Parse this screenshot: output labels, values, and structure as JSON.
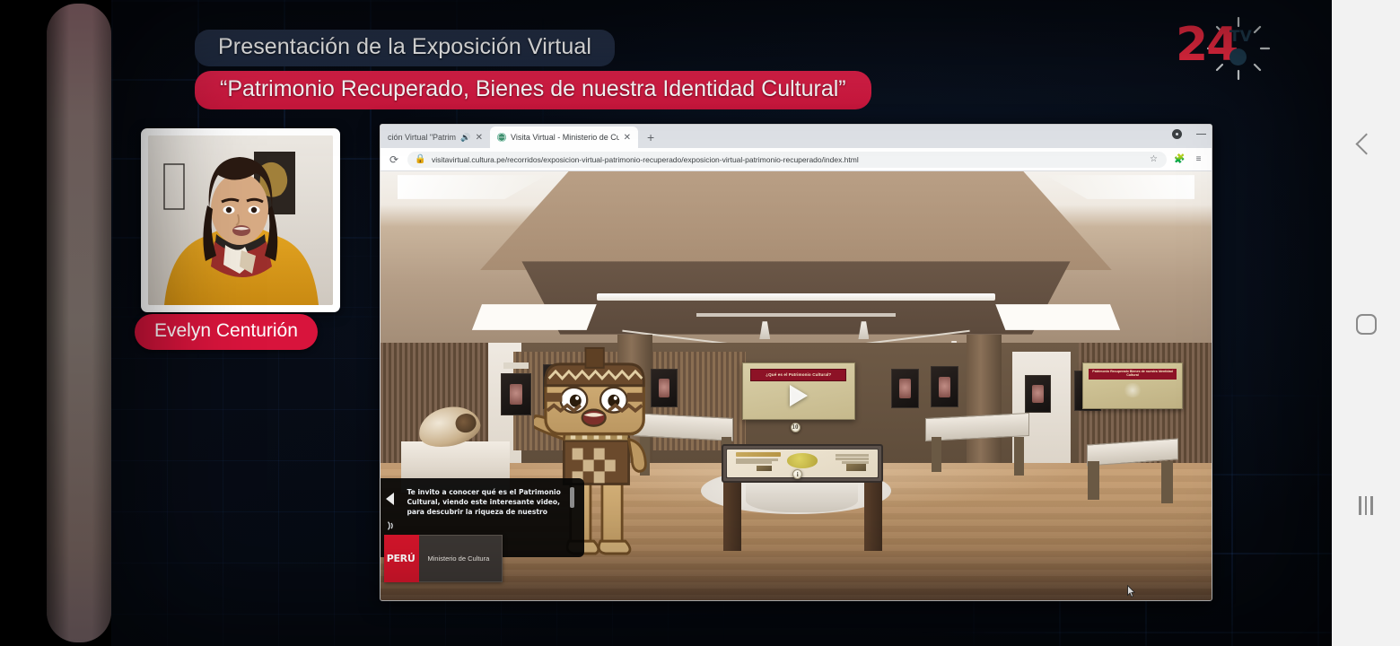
{
  "broadcast": {
    "title_line1": "Presentación de la Exposición Virtual",
    "title_line2": "“Patrimonio Recuperado, Bienes de nuestra Identidad Cultural”",
    "channel_logo_number": "24",
    "channel_logo_suffix": "TV",
    "speaker_name": "Evelyn Centurión",
    "colors": {
      "accent_red": "#d8143c",
      "banner_dark_blue": "#27334b",
      "logo_red": "#ef2a42",
      "logo_teal": "#1d3b4f",
      "background_navy": "#05080f"
    }
  },
  "browser": {
    "tabs": [
      {
        "title": "ción Virtual \"Patrimoni",
        "active": false,
        "audio_icon": "speaker-icon",
        "close_icon": "close-icon"
      },
      {
        "title": "Visita Virtual - Ministerio de Cult",
        "active": true,
        "favicon": "globe-icon",
        "close_icon": "close-icon"
      }
    ],
    "new_tab_label": "+",
    "window_controls": {
      "profile_icon": "profile-dot-icon",
      "minimize_icon": "minimize-icon"
    },
    "toolbar": {
      "reload_icon": "reload-icon",
      "lock_icon": "padlock-icon",
      "url": "visitavirtual.cultura.pe/recorridos/exposicion-virtual-patrimonio-recuperado/exposicion-virtual-patrimonio-recuperado/index.html",
      "bookmark_icon": "star-icon",
      "extensions_icon": "puzzle-icon",
      "menu_icon": "list-menu-icon"
    }
  },
  "virtual_tour": {
    "caption": "Te invito a conocer qué es el Patrimonio Cultural, viendo este interesante video, para descubrir la riqueza de nuestro",
    "prev_arrow_icon": "chevron-left-icon",
    "audio_icon": "audio-waves-icon",
    "video_card": {
      "headline": "¿Qué es el Patrimonio Cultural?",
      "play_icon": "play-icon"
    },
    "right_banner": {
      "headline": "Patrimonio Recuperado Bienes de nuestra Identidad Cultural"
    },
    "hotspots": [
      {
        "label": "10",
        "name": "hotspot-navigation"
      },
      {
        "label": "i",
        "name": "hotspot-info"
      }
    ],
    "footer_logo": {
      "country": "PERÚ",
      "institution": "Ministerio de Cultura"
    },
    "cursor_icon": "mouse-pointer-icon"
  },
  "device_nav": {
    "back_label": "Back",
    "home_label": "Home",
    "recents_label": "Recent apps"
  }
}
